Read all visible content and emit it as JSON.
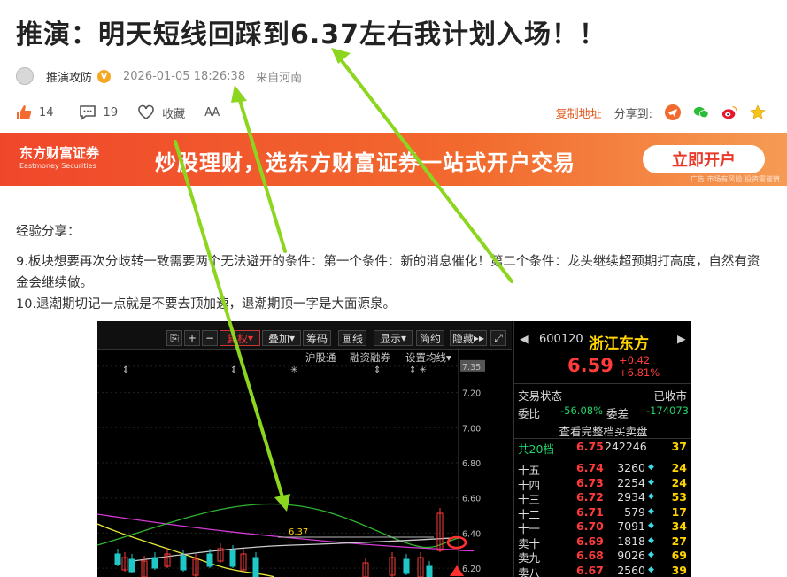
{
  "article": {
    "title": "推演：明天短线回踩到6.37左右我计划入场！！",
    "author": "推演攻防",
    "verified_badge": "V",
    "timestamp": "2026-01-05 18:26:38",
    "location": "来自河南"
  },
  "actions": {
    "likes": "14",
    "comments": "19",
    "favorite_label": "收藏",
    "font_size_label": "AA",
    "copy_link_label": "复制地址",
    "share_label": "分享到:"
  },
  "banner": {
    "brand_cn": "东方财富证券",
    "brand_en": "Eastmoney Securities",
    "slogan": "炒股理财，选东方财富证券一站式开户交易",
    "button": "立即开户",
    "ad_note": "广告 市场有风险 投资需谨慎"
  },
  "content": {
    "heading": "经验分享：",
    "point9": "9.板块想要再次分歧转一致需要两个无法避开的条件：第一个条件：新的消息催化！第二个条件：龙头继续超预期打高度，自然有资金会继续做。",
    "point10": "10.退潮期切记一点就是不要去顶加速，退潮期顶一字是大面源泉。"
  },
  "chart": {
    "toolbar": {
      "fuquan": "复权",
      "diejia": "叠加",
      "choumai": "筹码",
      "huaxian": "画线",
      "xianshi": "显示",
      "jianyue": "简约",
      "yincang": "隐藏"
    },
    "subbar": {
      "hugutong": "沪股通",
      "rongzi": "融资融券",
      "junxian": "设置均线"
    },
    "price_axis": [
      "7.35",
      "7.20",
      "7.00",
      "6.80",
      "6.60",
      "6.40",
      "6.20"
    ],
    "annotation_line_label": "6.37",
    "colors": {
      "up": "#ff3b3b",
      "down": "#22d36b",
      "accent": "#ffd400",
      "ma_yellow": "#e8e838",
      "ma_magenta": "#d63ad6",
      "ma_green": "#2fb52f",
      "ma_white": "#cccccc"
    },
    "chart_data": {
      "type": "candlestick",
      "ylim": [
        6.15,
        7.45
      ],
      "ma_lines_note": "",
      "marker_line": 6.37
    }
  },
  "quote": {
    "code": "600120",
    "name": "浙江东方",
    "price": "6.59",
    "change": "+0.42",
    "change_pct": "+6.81%",
    "status_label": "交易状态",
    "status_value": "已收市",
    "weibi_label": "委比",
    "weibi_value": "-56.08%",
    "weicha_label": "委差",
    "weicha_value": "-174073",
    "full_book_label": "查看完整档买卖盘",
    "summary_label": "共20档",
    "summary_price": "6.75",
    "summary_volume": "242246",
    "summary_count": "37",
    "orders": [
      {
        "level": "十五",
        "price": "6.74",
        "volume": "3260",
        "count": "24"
      },
      {
        "level": "十四",
        "price": "6.73",
        "volume": "2254",
        "count": "24"
      },
      {
        "level": "十三",
        "price": "6.72",
        "volume": "2934",
        "count": "53"
      },
      {
        "level": "十二",
        "price": "6.71",
        "volume": "579",
        "count": "17"
      },
      {
        "level": "十一",
        "price": "6.70",
        "volume": "7091",
        "count": "34"
      },
      {
        "level": "卖十",
        "price": "6.69",
        "volume": "1818",
        "count": "27"
      },
      {
        "level": "卖九",
        "price": "6.68",
        "volume": "9026",
        "count": "69"
      },
      {
        "level": "卖八",
        "price": "6.67",
        "volume": "2560",
        "count": "39"
      }
    ]
  }
}
